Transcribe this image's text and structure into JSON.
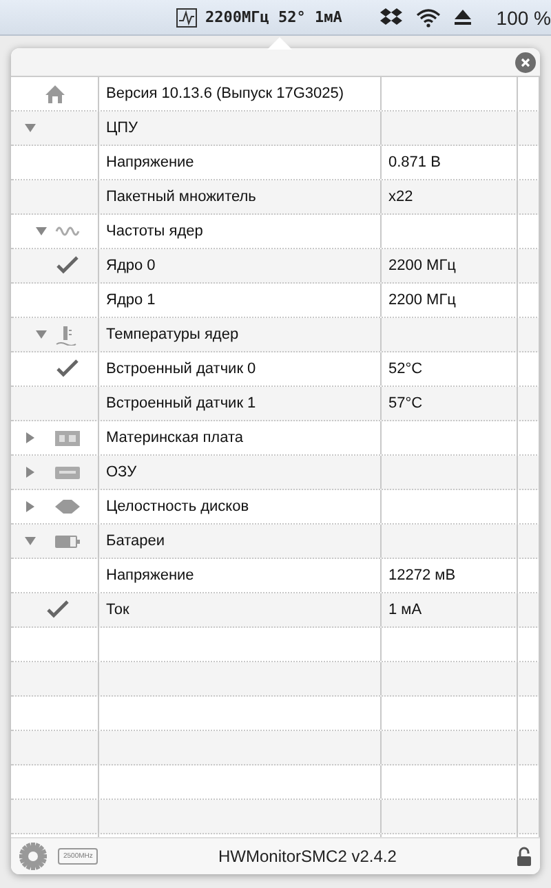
{
  "menubar": {
    "monitor_text": "2200МГц 52° 1мА",
    "battery_text": "100 %"
  },
  "tree": [
    {
      "kind": "version",
      "name": "Версия 10.13.6 (Выпуск 17G3025)"
    },
    {
      "kind": "cpu",
      "name": "ЦПУ",
      "expanded": true,
      "children": [
        {
          "name": "Напряжение",
          "value": "0.871 В",
          "checked": false
        },
        {
          "name": "Пакетный множитель",
          "value": "x22",
          "checked": false
        },
        {
          "kind": "frequency",
          "name": "Частоты ядер",
          "expanded": true,
          "children": [
            {
              "name": "Ядро 0",
              "value": "2200 МГц",
              "checked": true
            },
            {
              "name": "Ядро 1",
              "value": "2200 МГц",
              "checked": false
            }
          ]
        },
        {
          "kind": "temperature",
          "name": "Температуры ядер",
          "expanded": true,
          "children": [
            {
              "name": "Встроенный датчик 0",
              "value": "52°C",
              "checked": true
            },
            {
              "name": "Встроенный датчик 1",
              "value": "57°C",
              "checked": false
            }
          ]
        }
      ]
    },
    {
      "kind": "board",
      "name": "Материнская плата",
      "expanded": false
    },
    {
      "kind": "ram",
      "name": "ОЗУ",
      "expanded": false
    },
    {
      "kind": "disk",
      "name": "Целостность дисков",
      "expanded": false
    },
    {
      "kind": "battery",
      "name": "Батареи",
      "expanded": true,
      "children": [
        {
          "name": "Напряжение",
          "value": "12272 мВ",
          "checked": false
        },
        {
          "name": "Ток",
          "value": "1 мА",
          "checked": true
        }
      ]
    }
  ],
  "footer": {
    "badge": "2500MHz",
    "title": "HWMonitorSMC2 v2.4.2"
  }
}
